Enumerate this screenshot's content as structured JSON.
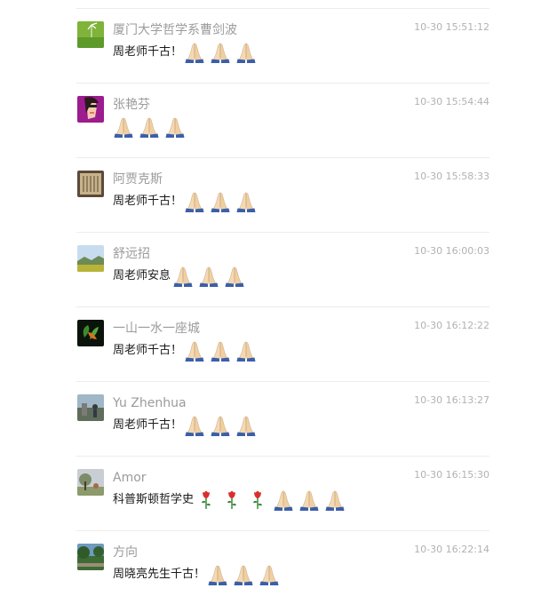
{
  "colors": {
    "name": "#9b9b9b",
    "time": "#b2b2b2",
    "text": "#1a1a1a",
    "divider": "#ececec",
    "sleeve": "#3b5fa8",
    "skin": "#f4d9b4",
    "rose": "#d92f2f",
    "stem": "#3a8a3a"
  },
  "comments": [
    {
      "name": "厦门大学哲学系曹剑波",
      "time": "10-30 15:51:12",
      "text": "周老师千古！",
      "emoji": [
        "pray-icon",
        "pray-icon",
        "pray-icon"
      ],
      "avatar": "avatar-green-field"
    },
    {
      "name": "张艳芬",
      "time": "10-30 15:54:44",
      "text": "",
      "emoji": [
        "pray-icon",
        "pray-icon",
        "pray-icon"
      ],
      "avatar": "avatar-cartoon-face"
    },
    {
      "name": "阿贾克斯",
      "time": "10-30 15:58:33",
      "text": "周老师千古！",
      "emoji": [
        "pray-icon",
        "pray-icon",
        "pray-icon"
      ],
      "avatar": "avatar-calligraphy"
    },
    {
      "name": "舒远招",
      "time": "10-30 16:00:03",
      "text": "周老师安息",
      "emoji": [
        "pray-icon",
        "pray-icon",
        "pray-icon"
      ],
      "avatar": "avatar-landscape"
    },
    {
      "name": "一山一水一座城",
      "time": "10-30 16:12:22",
      "text": "周老师千古！",
      "emoji": [
        "pray-icon",
        "pray-icon",
        "pray-icon"
      ],
      "avatar": "avatar-leaves"
    },
    {
      "name": "Yu Zhenhua",
      "time": "10-30 16:13:27",
      "text": "周老师千古！",
      "emoji": [
        "pray-icon",
        "pray-icon",
        "pray-icon"
      ],
      "avatar": "avatar-outdoor"
    },
    {
      "name": "Amor",
      "time": "10-30 16:15:30",
      "text": "科普斯顿哲学史",
      "emoji": [
        "rose-icon",
        "rose-icon",
        "rose-icon",
        "pray-icon",
        "pray-icon",
        "pray-icon"
      ],
      "avatar": "avatar-tree"
    },
    {
      "name": "方向",
      "time": "10-30 16:22:14",
      "text": "周晓亮先生千古！",
      "emoji": [
        "pray-icon",
        "pray-icon",
        "pray-icon"
      ],
      "avatar": "avatar-garden"
    }
  ]
}
